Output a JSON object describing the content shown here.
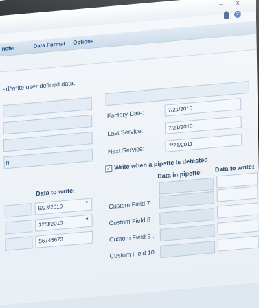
{
  "window": {
    "controls": "– x"
  },
  "menu": {
    "items": [
      "nsfer",
      "Data Format",
      "Options"
    ]
  },
  "description": "ad/write user defined data.",
  "service": {
    "factory_label": "Factory Date:",
    "factory_value": "7/21/2010",
    "last_label": "Last Service:",
    "last_value": "7/21/2010",
    "next_label": "Next Service:",
    "next_value": "7/21/2011"
  },
  "left_partial_text": "n",
  "left_header": "Data to write:",
  "left_rows": [
    "9/23/2010",
    "12/3/2010",
    "56745673"
  ],
  "pipette": {
    "checkbox_label": "Write when a pipette is detected",
    "checked": true,
    "col_in_pipette": "Data in pipette:",
    "col_to_write": "Data to write:",
    "fields": [
      "Custom Field 7 :",
      "Custom Field 8 :",
      "Custom Field 9 :",
      "Custom Field 10 :"
    ]
  },
  "icons": [
    "person-icon",
    "help-icon",
    "checkbox-checked-icon",
    "dropdown-arrow-icon"
  ]
}
